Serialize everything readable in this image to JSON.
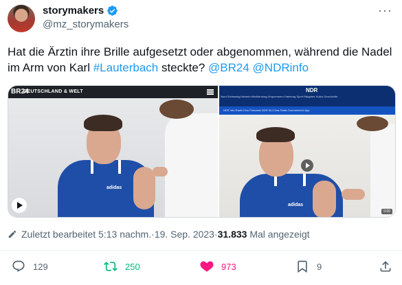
{
  "author": {
    "display_name": "storymakers",
    "handle": "@mz_storymakers",
    "verified": true
  },
  "tweet": {
    "text_parts": [
      {
        "text": "Hat die Ärztin ihre Brille aufgesetzt oder abgenommen, während die Nadel im Arm von Karl ",
        "type": "text"
      },
      {
        "text": "#Lauterbach",
        "type": "hashtag"
      },
      {
        "text": " steckte? ",
        "type": "text"
      },
      {
        "text": "@BR24",
        "type": "mention"
      },
      {
        "text": " ",
        "type": "text"
      },
      {
        "text": "@NDRinfo",
        "type": "mention"
      }
    ]
  },
  "media": {
    "left": {
      "logo": "BR24",
      "section_label": "DEUTSCHLAND & WELT",
      "shirt_logo": "adidas"
    },
    "right": {
      "logo": "NDR",
      "nav_text": "Nord   Schleswig-Holstein   Mecklenburg-Vorpommern   Hamburg   Sport   Ratgeber   Kultur   Geschichte",
      "sub_text": "NDR Info   Radio Kino   Podcasts   NDR 90,3   Das Radio   Dachsbericht   App",
      "shirt_logo": "adidas",
      "badge": "0:00"
    }
  },
  "meta": {
    "edited_label": "Zuletzt bearbeitet 5:13 nachm.",
    "separator": " · ",
    "date": "19. Sep. 2023",
    "views_count": "31.833",
    "views_label": "Mal angezeigt"
  },
  "actions": {
    "replies": "129",
    "retweets": "250",
    "likes": "973",
    "bookmarks": "9"
  },
  "colors": {
    "link": "#1d9bf0",
    "retweet": "#00ba7c",
    "like": "#f91880",
    "verified": "#1d9bf0",
    "muted": "#536471"
  },
  "icons": {
    "more": "more-icon",
    "verified": "verified-badge-icon",
    "pencil": "pencil-icon",
    "reply": "reply-icon",
    "retweet": "retweet-icon",
    "like": "heart-icon",
    "bookmark": "bookmark-icon",
    "share": "share-icon",
    "play": "play-icon"
  }
}
